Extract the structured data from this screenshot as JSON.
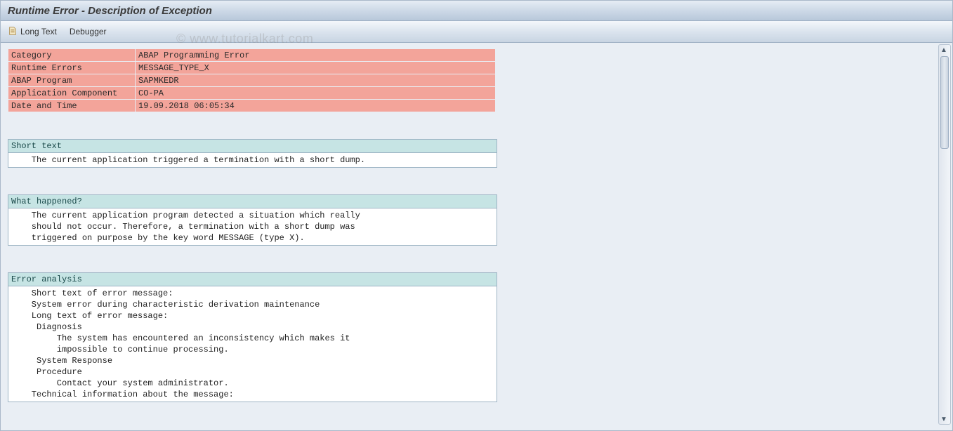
{
  "title": "Runtime Error - Description of Exception",
  "toolbar": {
    "long_text": "Long Text",
    "debugger": "Debugger"
  },
  "info": {
    "rows": [
      {
        "label": "Category",
        "value": "ABAP Programming Error"
      },
      {
        "label": "Runtime Errors",
        "value": "MESSAGE_TYPE_X"
      },
      {
        "label": "ABAP Program",
        "value": "SAPMKEDR"
      },
      {
        "label": "Application Component",
        "value": "CO-PA"
      },
      {
        "label": "Date and Time",
        "value": "19.09.2018 06:05:34"
      }
    ]
  },
  "sections": {
    "short_text": {
      "title": "Short text",
      "lines": [
        "    The current application triggered a termination with a short dump."
      ]
    },
    "what_happened": {
      "title": "What happened?",
      "lines": [
        "    The current application program detected a situation which really",
        "    should not occur. Therefore, a termination with a short dump was",
        "    triggered on purpose by the key word MESSAGE (type X)."
      ]
    },
    "error_analysis": {
      "title": "Error analysis",
      "lines": [
        "    Short text of error message:",
        "    System error during characteristic derivation maintenance",
        "",
        "    Long text of error message:",
        "     Diagnosis",
        "         The system has encountered an inconsistency which makes it",
        "         impossible to continue processing.",
        "     System Response",
        "     Procedure",
        "         Contact your system administrator.",
        "",
        "    Technical information about the message:"
      ]
    }
  },
  "watermark": "© www.tutorialkart.com"
}
